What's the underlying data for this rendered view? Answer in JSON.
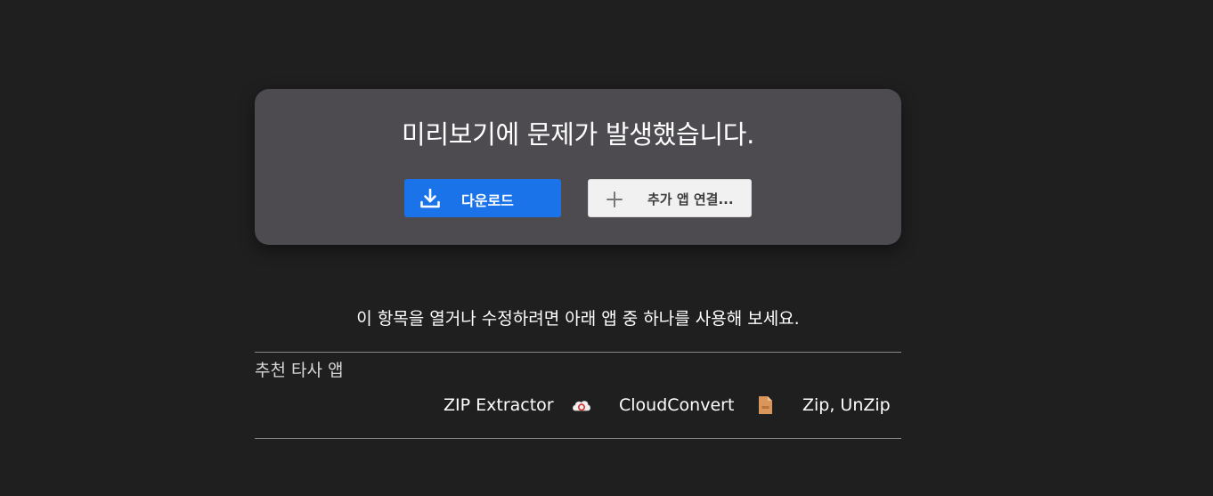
{
  "preview": {
    "error_title": "미리보기에 문제가 발생했습니다.",
    "download_label": "다운로드",
    "connect_label": "추가 앱 연결..."
  },
  "hint": "이 항목을 열거나 수정하려면 아래 앱 중 하나를 사용해 보세요.",
  "recommended": {
    "title": "추천 타사 앱",
    "apps": [
      {
        "label": "ZIP Extractor",
        "icon": "none"
      },
      {
        "label": "CloudConvert",
        "icon": "cloudconvert-icon"
      },
      {
        "label": "Zip, UnZip",
        "icon": "zip-file-icon"
      }
    ]
  },
  "colors": {
    "background": "#1f1f1f",
    "card": "#4d4b4f",
    "primary_button": "#1a73e8",
    "secondary_button": "#f1f1f1"
  }
}
